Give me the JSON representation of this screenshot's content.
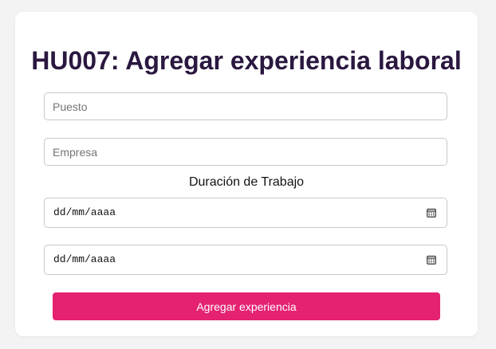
{
  "page": {
    "title": "HU007: Agregar experiencia laboral"
  },
  "form": {
    "puesto_placeholder": "Puesto",
    "puesto_value": "",
    "empresa_placeholder": "Empresa",
    "empresa_value": "",
    "duracion_label": "Duración de Trabajo",
    "fecha_inicio_placeholder": "dd/mm/aaaa",
    "fecha_fin_placeholder": "dd/mm/aaaa",
    "submit_label": "Agregar experiencia",
    "date_icon": "calendar-icon"
  },
  "colors": {
    "background": "#f3f3f3",
    "card": "#ffffff",
    "title": "#2a1840",
    "accent": "#e52272",
    "border": "#c9c9c9"
  }
}
